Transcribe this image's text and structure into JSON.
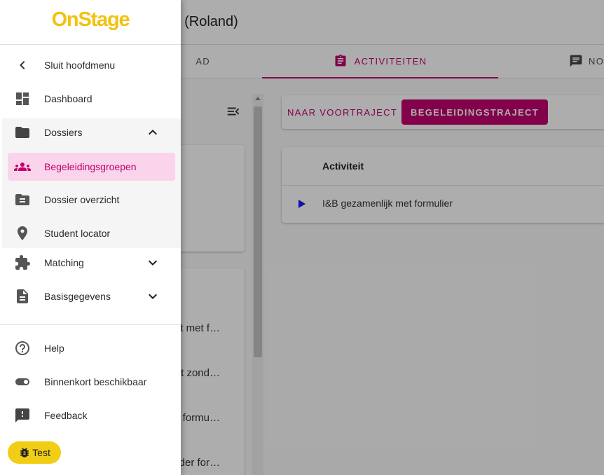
{
  "app": {
    "title": ". (Roland)",
    "tabs": [
      {
        "label": "AD",
        "icon": "dashboard-icon"
      },
      {
        "label": "ACTIVITEITEN",
        "icon": "clipboard-icon",
        "active": true
      },
      {
        "label": "NO",
        "icon": "notes-icon"
      }
    ],
    "left_list": {
      "rows": [
        "t met f…",
        "t zond…",
        "formu…",
        "der for…"
      ]
    },
    "trajects": {
      "pre_label": "NAAR VOORTRAJECT",
      "main_label": "BEGELEIDINGSTRAJECT"
    },
    "activities_table": {
      "header": "Activiteit",
      "rows": [
        "I&B gezamenlijk met formulier"
      ]
    },
    "accent_color": "#c2006f"
  },
  "drawer": {
    "logo": "OnStage",
    "logo_color": "#f2c20f",
    "items": [
      {
        "label": "Sluit hoofdmenu",
        "icon": "chevron-left-icon"
      },
      {
        "label": "Dashboard",
        "icon": "dashboard-icon"
      },
      {
        "label": "Dossiers",
        "icon": "folder-icon",
        "expanded": true
      },
      {
        "label": "Begeleidingsgroepen",
        "icon": "groups-icon",
        "active": true
      },
      {
        "label": "Dossier overzicht",
        "icon": "folder-file-icon"
      },
      {
        "label": "Student locator",
        "icon": "location-pin-icon"
      },
      {
        "label": "Matching",
        "icon": "puzzle-icon"
      },
      {
        "label": "Basisgegevens",
        "icon": "document-icon"
      },
      {
        "label": "Help",
        "icon": "help-icon"
      },
      {
        "label": "Binnenkort beschikbaar",
        "icon": "toggle-icon"
      },
      {
        "label": "Feedback",
        "icon": "feedback-icon"
      }
    ],
    "chip": {
      "label": "Test",
      "icon": "bug-icon"
    }
  }
}
